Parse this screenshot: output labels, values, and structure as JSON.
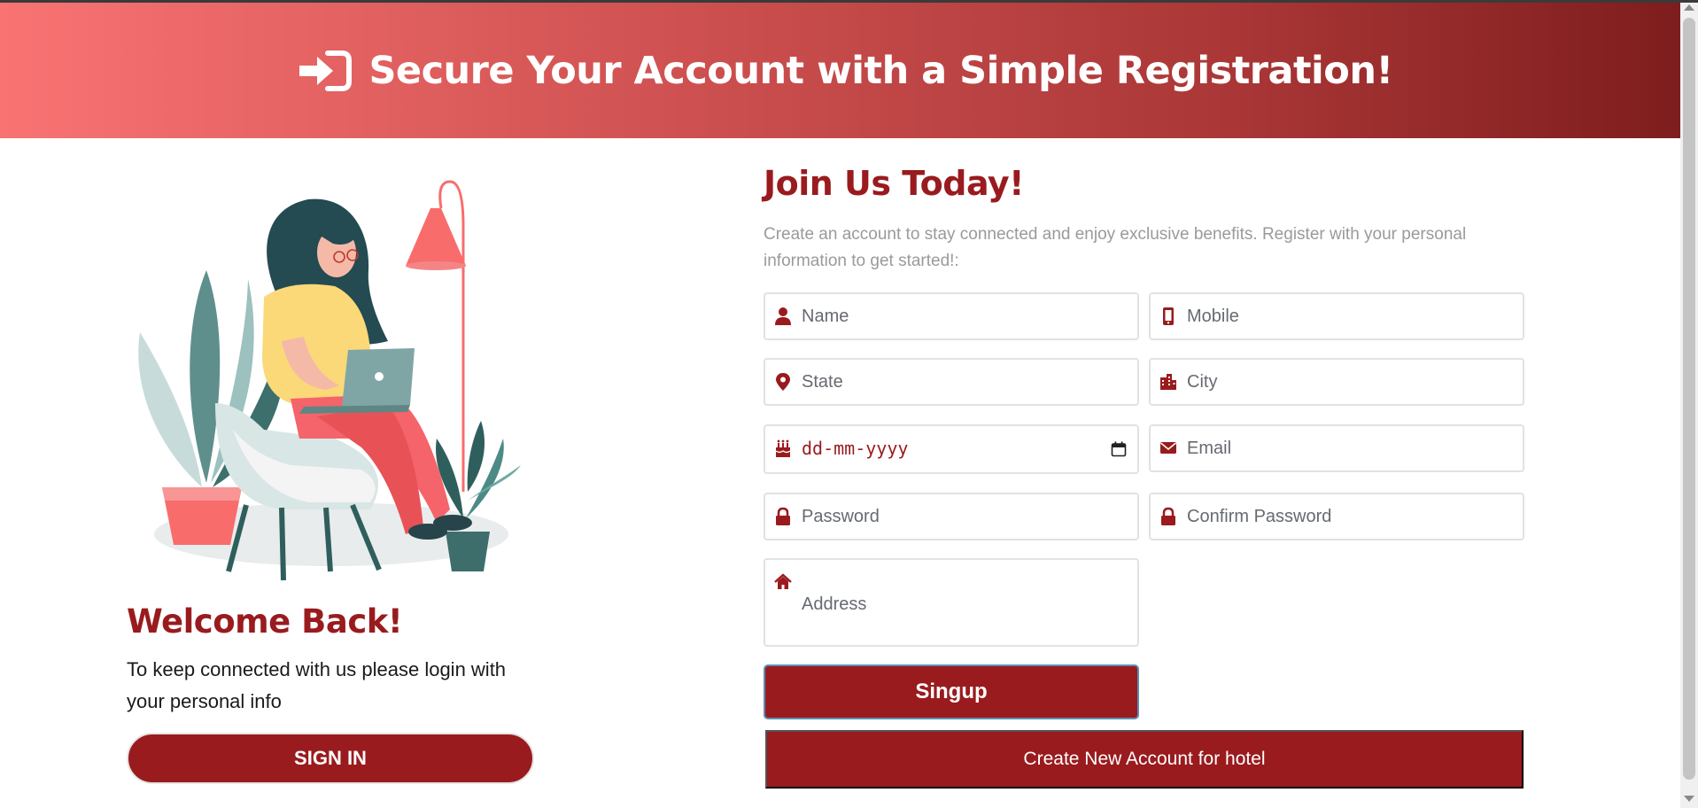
{
  "banner": {
    "title": "Secure Your Account with a Simple Registration!",
    "icon": "sign-in-icon"
  },
  "left": {
    "illustration": "woman-with-laptop-illustration",
    "welcome_title": "Welcome Back!",
    "welcome_text": "To keep connected with us please login with your personal info",
    "signin_label": "SIGN IN"
  },
  "form": {
    "title": "Join Us Today!",
    "subtitle": "Create an account to stay connected and enjoy exclusive benefits. Register with your personal information to get started!:",
    "fields": {
      "name": {
        "placeholder": "Name",
        "icon": "user-icon"
      },
      "mobile": {
        "placeholder": "Mobile",
        "icon": "mobile-icon"
      },
      "state": {
        "placeholder": "State",
        "icon": "map-marker-icon"
      },
      "city": {
        "placeholder": "City",
        "icon": "city-icon"
      },
      "dob": {
        "placeholder": "dd-mm-yyyy",
        "icon": "birthday-cake-icon"
      },
      "email": {
        "placeholder": "Email",
        "icon": "envelope-icon"
      },
      "password": {
        "placeholder": "Password",
        "icon": "lock-icon"
      },
      "confirm_password": {
        "placeholder": "Confirm Password",
        "icon": "lock-icon"
      },
      "address": {
        "placeholder": "Address",
        "icon": "home-icon"
      }
    },
    "signup_label": "Singup",
    "hotel_label": "Create New Account for hotel"
  },
  "colors": {
    "accent": "#991b1e",
    "banner_start": "#f97373",
    "banner_end": "#7e1d1d",
    "muted_text": "#9a9a9a"
  }
}
